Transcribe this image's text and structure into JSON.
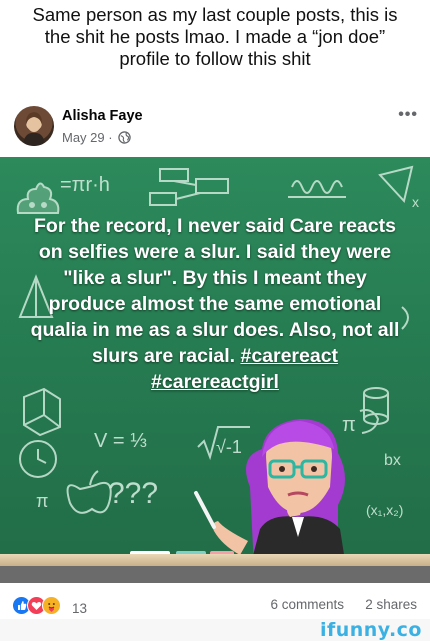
{
  "caption": "Same person as my last couple posts, this is the shit he posts lmao. I made a “jon doe” profile to follow this shit",
  "post": {
    "author": "Alisha Faye",
    "date": "May 29 ·",
    "more_icon": "more-horizontal-icon",
    "privacy_icon": "globe-icon",
    "text_before": "For the record, I never said Care reacts on selfies were a slur. I said they were \"like a slur\". By this I meant they produce almost the same emotional qualia in me as a slur does. Also, not all slurs are racial. ",
    "hashtag1": "#carereact",
    "hashtag2": "#carereactgirl",
    "background_color": "#2a8558"
  },
  "board_doodles": {
    "top_left": "=πr·h",
    "eq_v": "V = ⅓",
    "sqrt": "√-1",
    "qmarks": "???",
    "pi_left": "π",
    "pi_right": "π",
    "bx": "bx",
    "x_pair": "(x₁,x₂)",
    "x_small": "x"
  },
  "footer_bar": {
    "reaction_icons": [
      "like-icon",
      "love-icon",
      "care-icon"
    ],
    "reaction_count": "13",
    "comments": "6 comments",
    "shares": "2 shares"
  },
  "watermark": "ifunny.co",
  "colors": {
    "like": "#1877f2",
    "love": "#f33e58",
    "care": "#f7b125",
    "watermark": "#3bb1e3"
  }
}
